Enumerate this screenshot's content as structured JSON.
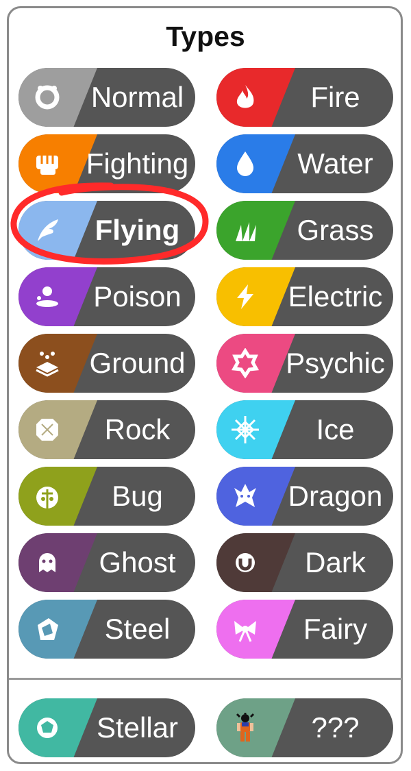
{
  "title": "Types",
  "types": [
    {
      "label": "Normal",
      "color": "#9e9e9e",
      "icon": "ring-icon"
    },
    {
      "label": "Fire",
      "color": "#e8292b",
      "icon": "flame-icon"
    },
    {
      "label": "Fighting",
      "color": "#f77f00",
      "icon": "fist-icon"
    },
    {
      "label": "Water",
      "color": "#2a7ce8",
      "icon": "droplet-icon"
    },
    {
      "label": "Flying",
      "color": "#8bb7ee",
      "icon": "wing-icon"
    },
    {
      "label": "Grass",
      "color": "#3ba42c",
      "icon": "leaves-icon"
    },
    {
      "label": "Poison",
      "color": "#9240cd",
      "icon": "poison-icon"
    },
    {
      "label": "Electric",
      "color": "#f8bf00",
      "icon": "lightning-icon"
    },
    {
      "label": "Ground",
      "color": "#8c4f1e",
      "icon": "ground-icon"
    },
    {
      "label": "Psychic",
      "color": "#ec4a82",
      "icon": "psychic-icon"
    },
    {
      "label": "Rock",
      "color": "#b4ab82",
      "icon": "rock-icon"
    },
    {
      "label": "Ice",
      "color": "#3fd1f0",
      "icon": "snowflake-icon"
    },
    {
      "label": "Bug",
      "color": "#8fa11c",
      "icon": "bug-icon"
    },
    {
      "label": "Dragon",
      "color": "#4f63df",
      "icon": "dragon-icon"
    },
    {
      "label": "Ghost",
      "color": "#6e3f71",
      "icon": "ghost-icon"
    },
    {
      "label": "Dark",
      "color": "#4f3a38",
      "icon": "dark-icon"
    },
    {
      "label": "Steel",
      "color": "#5899b5",
      "icon": "steel-icon"
    },
    {
      "label": "Fairy",
      "color": "#ee6fef",
      "icon": "fairy-icon"
    }
  ],
  "extras": [
    {
      "label": "Stellar",
      "color": "#41b8a2",
      "icon": "stellar-icon"
    },
    {
      "label": "???",
      "color": "#6ea187",
      "icon": "character-icon"
    }
  ],
  "highlight": {
    "label": "Flying",
    "mark_color": "#ff2a2a"
  }
}
